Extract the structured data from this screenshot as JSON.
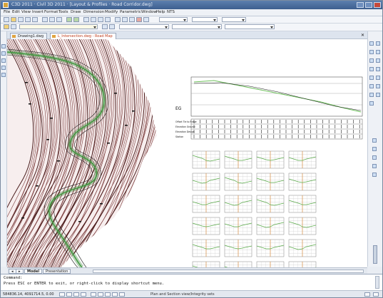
{
  "titlebar": {
    "title": "C3D 2011 · Civil 3D 2011 · [Layout & Profiles · Road Corridor.dwg]"
  },
  "menubar": {
    "items": [
      "File",
      "Edit",
      "View",
      "Insert",
      "Format",
      "Tools",
      "Draw",
      "Dimension",
      "Modify",
      "Parametric",
      "Window",
      "Help",
      "NTS"
    ]
  },
  "tabs": [
    {
      "label": "Drawing1.dwg"
    },
    {
      "label": "L_Intersection.dwg - Road Map"
    }
  ],
  "viewport": {
    "profile_label": "EG",
    "band_labels": [
      "Offset Tie to Ridge",
      "Elevation Ground",
      "Elevation Design",
      "Station"
    ]
  },
  "layout_tabs": [
    "Model",
    "Presentation"
  ],
  "command": {
    "history": "Command:",
    "prompt": "Press ESC or ENTER to exit, or right-click to display shortcut menu."
  },
  "status": {
    "coords": "584836.14, 4091714.5, 0.00",
    "message": "Plan and Section view/Integrity sets"
  },
  "colors": {
    "titlebar": "#3d5f8f",
    "contour": "#7a3a3a",
    "alignment": "#3d9a3d",
    "profile": "#6cbf5a"
  }
}
